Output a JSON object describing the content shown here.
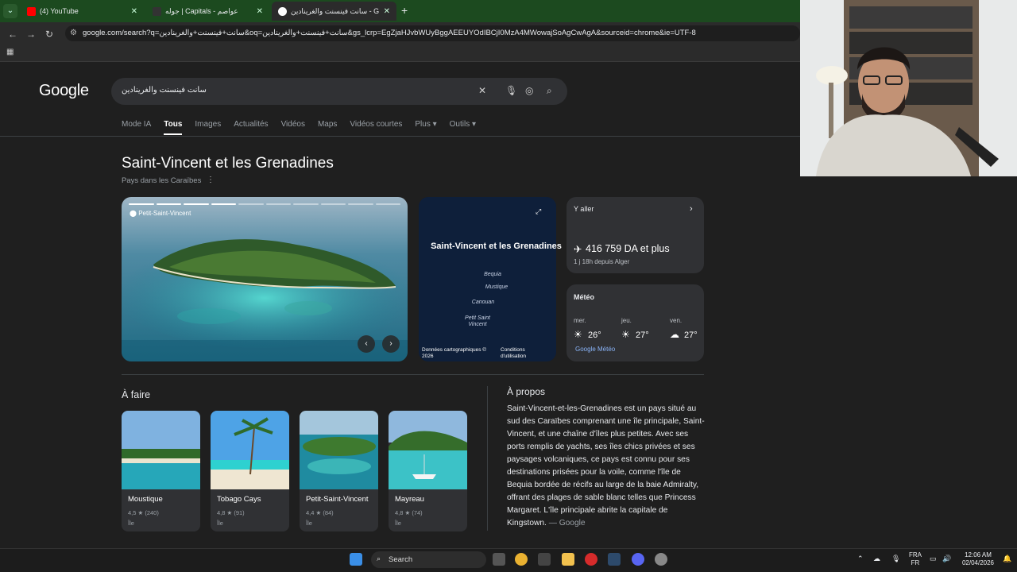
{
  "browser": {
    "tabs": [
      {
        "title": "(4) YouTube",
        "favicon_color": "#ff0000"
      },
      {
        "title": "جوله | Capitals - عواصم",
        "favicon_color": "#333333"
      },
      {
        "title": "سانت فينسنت والغرينادين - Google",
        "favicon_color": "#ffffff"
      }
    ],
    "url": "google.com/search?q=سانت+فينسنت+والغرينادين&oq=سانت+فينسنت+والغرينادين&gs_lcrp=EgZjaHJvbWUyBggAEEUYOdIBCjI0MzA4MWowajSoAgCwAgA&sourceid=chrome&ie=UTF-8"
  },
  "google": {
    "logo": "Google",
    "query": "سانت فينسنت والغرينادين",
    "nav_tabs": [
      "Mode IA",
      "Tous",
      "Images",
      "Actualités",
      "Vidéos",
      "Maps",
      "Vidéos courtes",
      "Plus ▾",
      "Outils ▾"
    ],
    "selected_tab": "Tous"
  },
  "panel": {
    "title": "Saint-Vincent et les Grenadines",
    "subtitle": "Pays dans les Caraïbes",
    "photo_label": "Petit-Saint-Vincent",
    "photo_progress_index": 4,
    "map": {
      "title": "Saint-Vincent et les Grenadines",
      "places": [
        "Bequia",
        "Mustique",
        "Canouan",
        "Petit Saint Vincent"
      ],
      "footer_left": "Données cartographiques © 2026",
      "footer_right": "Conditions d'utilisation"
    },
    "travel": {
      "header": "Y aller",
      "price": "416 759 DA et plus",
      "detail": "1 j 18h depuis Alger"
    },
    "weather": {
      "header": "Météo",
      "days": [
        {
          "day": "mer.",
          "temp": "26°",
          "icon": "partly-sunny-icon"
        },
        {
          "day": "jeu.",
          "temp": "27°",
          "icon": "partly-sunny-icon"
        },
        {
          "day": "ven.",
          "temp": "27°",
          "icon": "cloud-icon"
        }
      ],
      "link": "Google Météo"
    }
  },
  "todo": {
    "heading": "À faire",
    "items": [
      {
        "name": "Moustique",
        "rating": "4,5 ★ (240)",
        "type": "Île"
      },
      {
        "name": "Tobago Cays",
        "rating": "4,8 ★ (91)",
        "type": "Île"
      },
      {
        "name": "Petit-Saint-Vincent",
        "rating": "4,4 ★ (84)",
        "type": "Île"
      },
      {
        "name": "Mayreau",
        "rating": "4,8 ★ (74)",
        "type": "Île"
      }
    ]
  },
  "about": {
    "heading": "À propos",
    "text": "Saint-Vincent-et-les-Grenadines est un pays situé au sud des Caraïbes comprenant une île principale, Saint-Vincent, et une chaîne d'îles plus petites. Avec ses ports remplis de yachts, ses îles chics privées et ses paysages volcaniques, ce pays est connu pour ses destinations prisées pour la voile, comme l'île de Bequia bordée de récifs au large de la baie Admiralty, offrant des plages de sable blanc telles que Princess Margaret. L'île principale abrite la capitale de Kingstown.",
    "source": "— Google"
  },
  "taskbar": {
    "search_label": "Search",
    "lang_top": "FRA",
    "lang_bottom": "FR",
    "time": "12:06 AM",
    "date": "02/04/2026"
  }
}
